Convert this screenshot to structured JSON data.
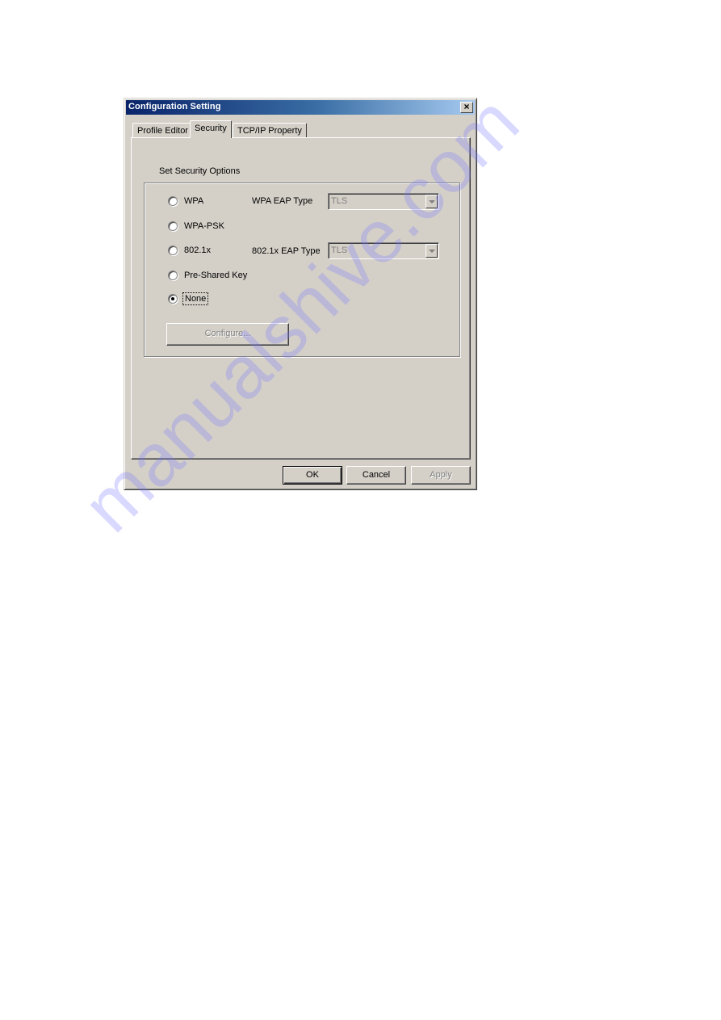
{
  "window": {
    "title": "Configuration Setting",
    "close_label": "×"
  },
  "tabs": [
    {
      "label": "Profile Editor",
      "active": false
    },
    {
      "label": "Security",
      "active": true
    },
    {
      "label": "TCP/IP Property",
      "active": false
    }
  ],
  "security": {
    "group_label": "Set Security Options",
    "options": [
      {
        "label": "WPA",
        "checked": false
      },
      {
        "label": "WPA-PSK",
        "checked": false
      },
      {
        "label": "802.1x",
        "checked": false
      },
      {
        "label": "Pre-Shared Key",
        "checked": false
      },
      {
        "label": "None",
        "checked": true
      }
    ],
    "wpa_eap": {
      "label": "WPA EAP Type",
      "value": "TLS",
      "enabled": false
    },
    "dot1x_eap": {
      "label": "802.1x EAP Type",
      "value": "TLS",
      "enabled": false
    },
    "configure_label": "Configure..."
  },
  "buttons": {
    "ok": "OK",
    "cancel": "Cancel",
    "apply": "Apply"
  },
  "watermark": "manualshive.com"
}
